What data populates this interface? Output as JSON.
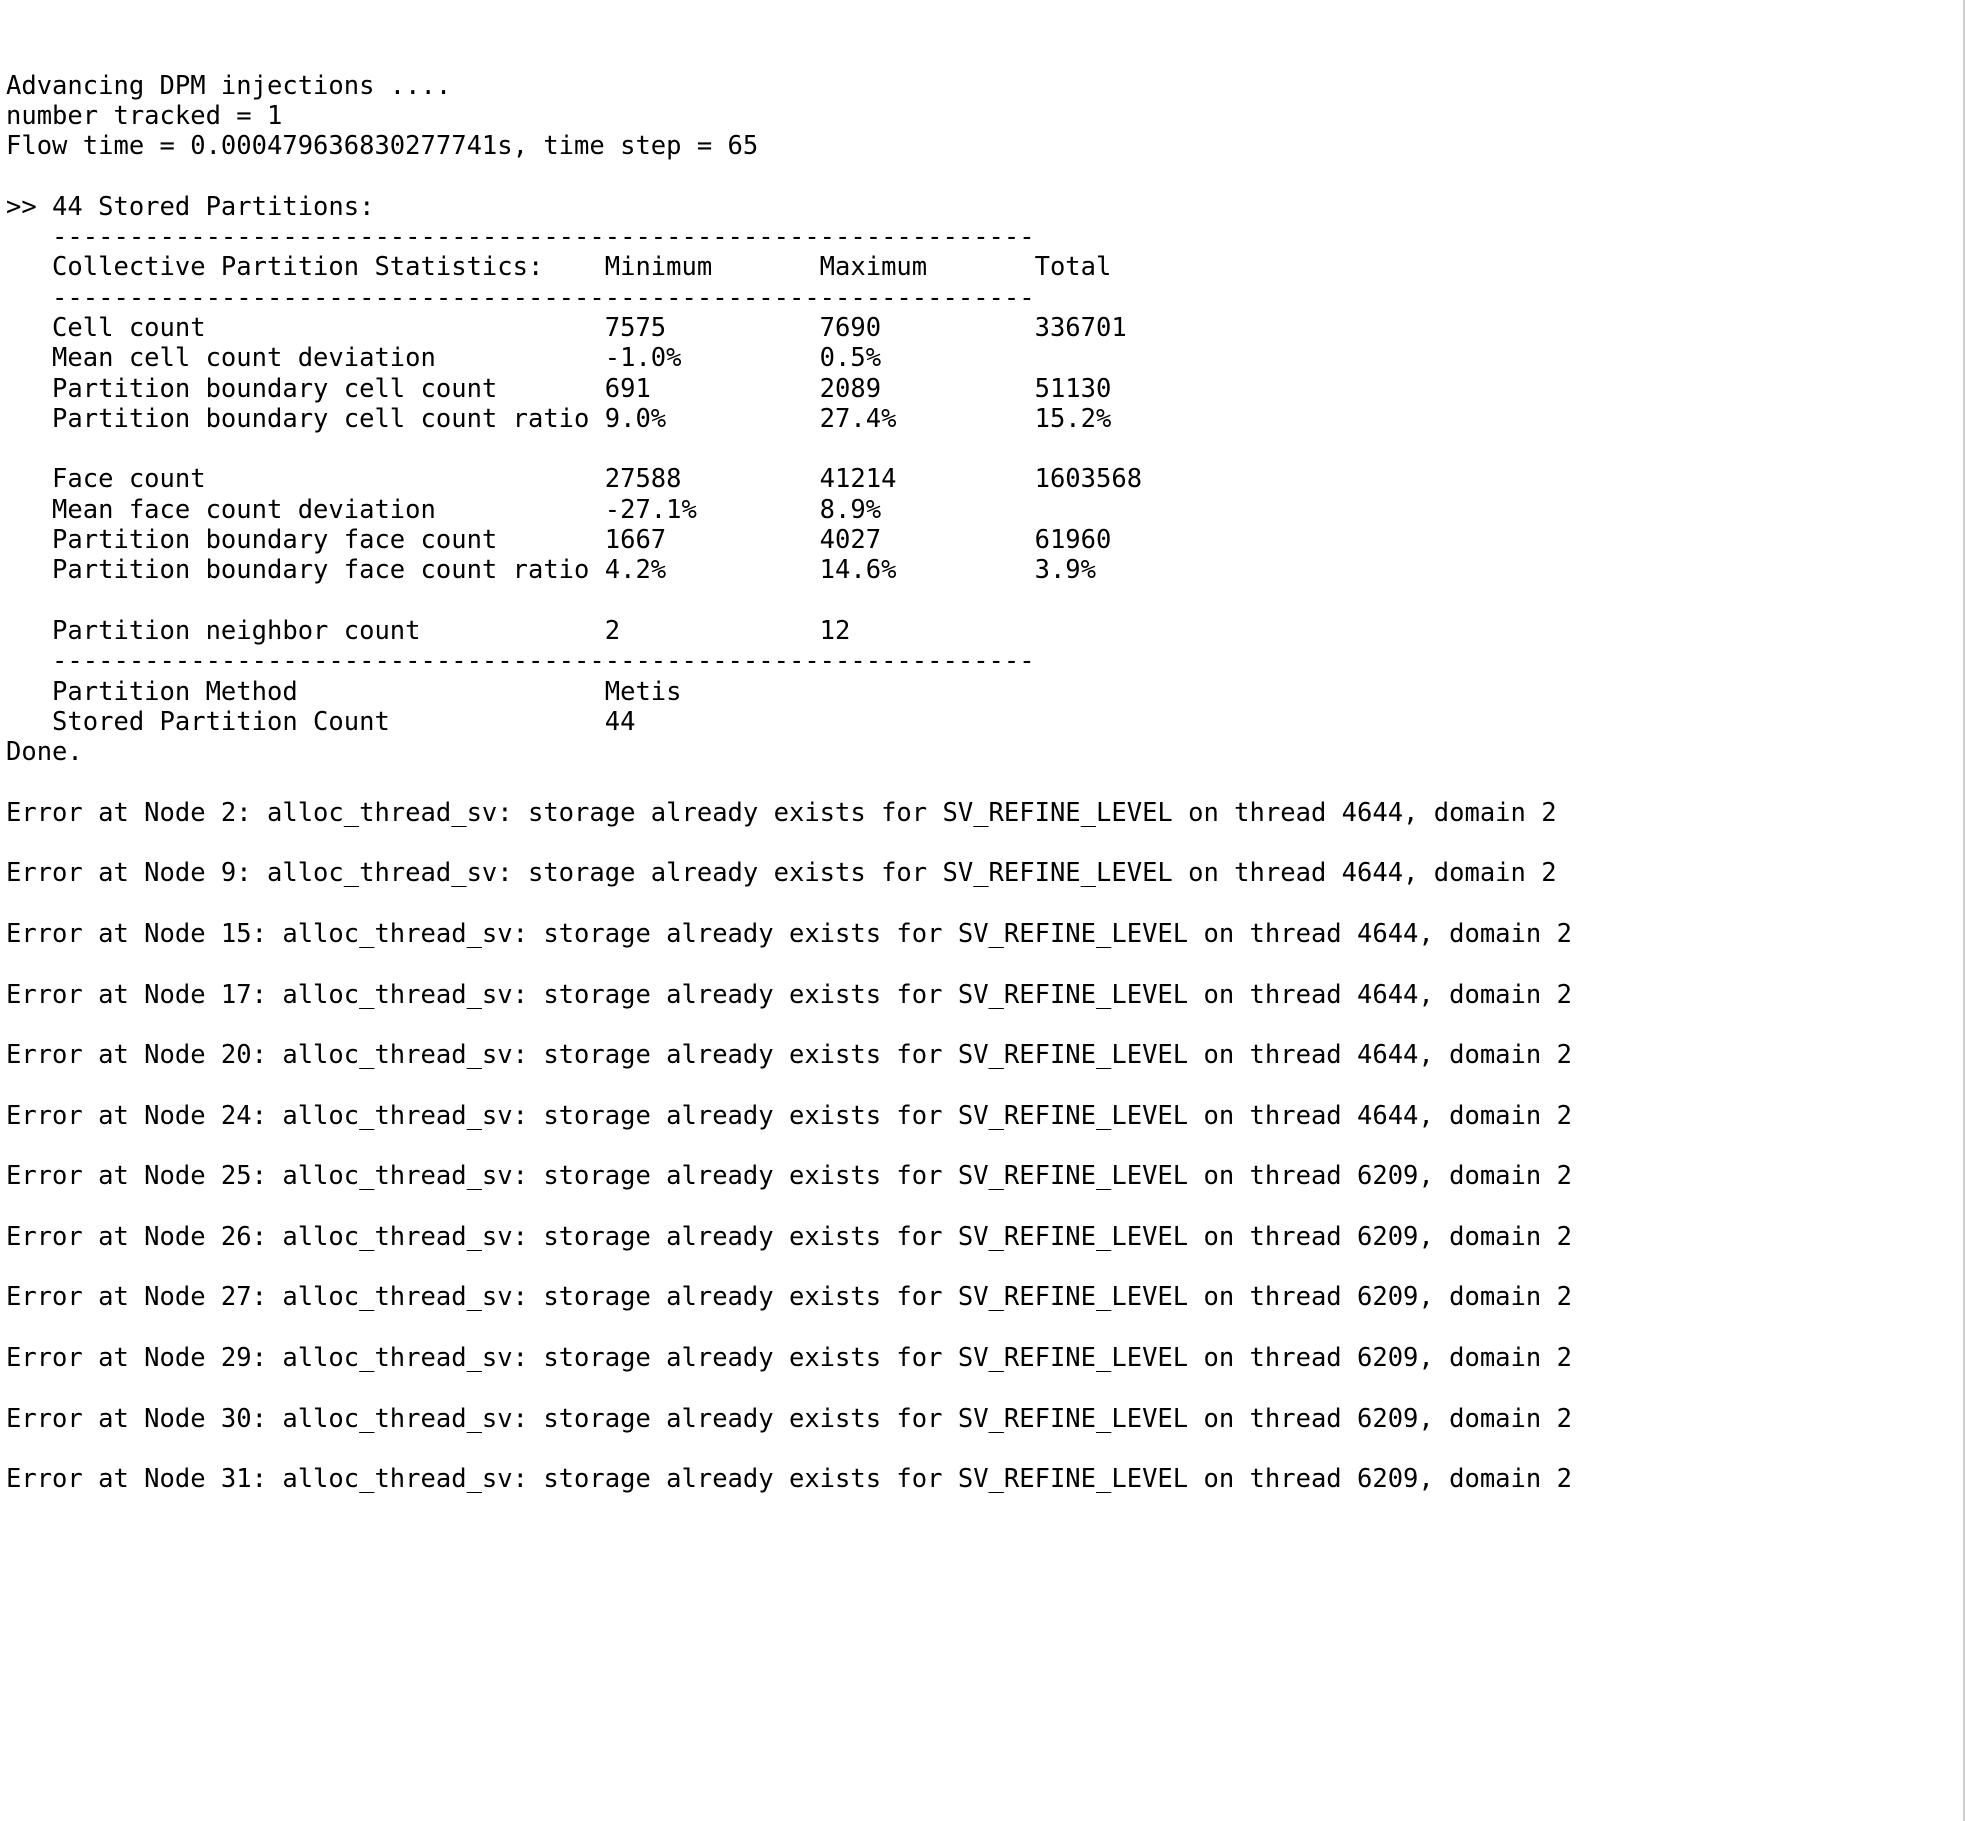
{
  "console": {
    "header": {
      "advancing_line": "Advancing DPM injections ....",
      "tracked_line": "number tracked = 1",
      "flow_time_line": "Flow time = 0.000479636830277741s, time step = 65"
    },
    "partitions": {
      "title": ">> 44 Stored Partitions:",
      "rule_top": "   ----------------------------------------------------------------",
      "rule_mid": "   ----------------------------------------------------------------",
      "rule_bottom": "   ----------------------------------------------------------------",
      "column_headers": {
        "label": "   Collective Partition Statistics:",
        "minimum": "Minimum",
        "maximum": "Maximum",
        "total": "Total"
      },
      "cell_rows": [
        {
          "label": "Cell count",
          "minimum": "7575",
          "maximum": "7690",
          "total": "336701"
        },
        {
          "label": "Mean cell count deviation",
          "minimum": "-1.0%",
          "maximum": "0.5%",
          "total": ""
        },
        {
          "label": "Partition boundary cell count",
          "minimum": "691",
          "maximum": "2089",
          "total": "51130"
        },
        {
          "label": "Partition boundary cell count ratio",
          "minimum": "9.0%",
          "maximum": "27.4%",
          "total": "15.2%"
        }
      ],
      "face_rows": [
        {
          "label": "Face count",
          "minimum": "27588",
          "maximum": "41214",
          "total": "1603568"
        },
        {
          "label": "Mean face count deviation",
          "minimum": "-27.1%",
          "maximum": "8.9%",
          "total": ""
        },
        {
          "label": "Partition boundary face count",
          "minimum": "1667",
          "maximum": "4027",
          "total": "61960"
        },
        {
          "label": "Partition boundary face count ratio",
          "minimum": "4.2%",
          "maximum": "14.6%",
          "total": "3.9%"
        }
      ],
      "neighbor_rows": [
        {
          "label": "Partition neighbor count",
          "minimum": "2",
          "maximum": "12",
          "total": ""
        }
      ],
      "method_rows": [
        {
          "label": "Partition Method",
          "value": "Metis"
        },
        {
          "label": "Stored Partition Count",
          "value": "44"
        }
      ]
    },
    "done_line": "Done.",
    "errors": [
      {
        "prefix": "Error at Node ",
        "node": "2",
        "middle": ": alloc_thread_sv: storage already exists for SV_REFINE_LEVEL on thread ",
        "thread": "4644",
        "suffix": ", domain ",
        "domain": "2"
      },
      {
        "prefix": "Error at Node ",
        "node": "9",
        "middle": ": alloc_thread_sv: storage already exists for SV_REFINE_LEVEL on thread ",
        "thread": "4644",
        "suffix": ", domain ",
        "domain": "2"
      },
      {
        "prefix": "Error at Node ",
        "node": "15",
        "middle": ": alloc_thread_sv: storage already exists for SV_REFINE_LEVEL on thread ",
        "thread": "4644",
        "suffix": ", domain ",
        "domain": "2"
      },
      {
        "prefix": "Error at Node ",
        "node": "17",
        "middle": ": alloc_thread_sv: storage already exists for SV_REFINE_LEVEL on thread ",
        "thread": "4644",
        "suffix": ", domain ",
        "domain": "2"
      },
      {
        "prefix": "Error at Node ",
        "node": "20",
        "middle": ": alloc_thread_sv: storage already exists for SV_REFINE_LEVEL on thread ",
        "thread": "4644",
        "suffix": ", domain ",
        "domain": "2"
      },
      {
        "prefix": "Error at Node ",
        "node": "24",
        "middle": ": alloc_thread_sv: storage already exists for SV_REFINE_LEVEL on thread ",
        "thread": "4644",
        "suffix": ", domain ",
        "domain": "2"
      },
      {
        "prefix": "Error at Node ",
        "node": "25",
        "middle": ": alloc_thread_sv: storage already exists for SV_REFINE_LEVEL on thread ",
        "thread": "6209",
        "suffix": ", domain ",
        "domain": "2"
      },
      {
        "prefix": "Error at Node ",
        "node": "26",
        "middle": ": alloc_thread_sv: storage already exists for SV_REFINE_LEVEL on thread ",
        "thread": "6209",
        "suffix": ", domain ",
        "domain": "2"
      },
      {
        "prefix": "Error at Node ",
        "node": "27",
        "middle": ": alloc_thread_sv: storage already exists for SV_REFINE_LEVEL on thread ",
        "thread": "6209",
        "suffix": ", domain ",
        "domain": "2"
      },
      {
        "prefix": "Error at Node ",
        "node": "29",
        "middle": ": alloc_thread_sv: storage already exists for SV_REFINE_LEVEL on thread ",
        "thread": "6209",
        "suffix": ", domain ",
        "domain": "2"
      },
      {
        "prefix": "Error at Node ",
        "node": "30",
        "middle": ": alloc_thread_sv: storage already exists for SV_REFINE_LEVEL on thread ",
        "thread": "6209",
        "suffix": ", domain ",
        "domain": "2"
      },
      {
        "prefix": "Error at Node ",
        "node": "31",
        "middle": ": alloc_thread_sv: storage already exists for SV_REFINE_LEVEL on thread ",
        "thread": "6209",
        "suffix": ", domain ",
        "domain": "2"
      }
    ],
    "colors": {
      "background": "#ffffff",
      "text": "#000000",
      "border": "#cfcfcf"
    }
  }
}
